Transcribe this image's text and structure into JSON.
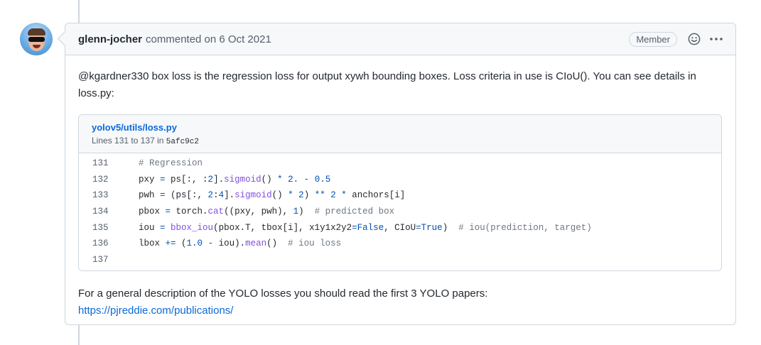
{
  "comment": {
    "author": "glenn-jocher",
    "meta": "commented on 6 Oct 2021",
    "badge": "Member",
    "body_text": "@kgardner330 box loss is the regression loss for output xywh bounding boxes. Loss criteria in use is CIoU(). You can see details in loss.py:",
    "icons": {
      "reaction": "smiley-icon",
      "more": "kebab-horizontal-icon"
    }
  },
  "snippet": {
    "file_path": "yolov5/utils/loss.py",
    "lines_prefix": "Lines 131 to 137 in",
    "sha": "5afc9c2",
    "lines": [
      {
        "num": "131",
        "text": "# Regression"
      },
      {
        "num": "132",
        "text": "pxy = ps[:, :2].sigmoid() * 2. - 0.5"
      },
      {
        "num": "133",
        "text": "pwh = (ps[:, 2:4].sigmoid() * 2) ** 2 * anchors[i]"
      },
      {
        "num": "134",
        "text": "pbox = torch.cat((pxy, pwh), 1)  # predicted box"
      },
      {
        "num": "135",
        "text": "iou = bbox_iou(pbox.T, tbox[i], x1y1x2y2=False, CIoU=True)  # iou(prediction, target)"
      },
      {
        "num": "136",
        "text": "lbox += (1.0 - iou).mean()  # iou loss"
      },
      {
        "num": "137",
        "text": ""
      }
    ]
  },
  "footer": {
    "text": "For a general description of the YOLO losses you should read the first 3 YOLO papers:",
    "link": "https://pjreddie.com/publications/"
  },
  "colors": {
    "link": "#0969da",
    "border": "#d0d7de",
    "header_bg": "#f6f8fa",
    "muted": "#57606a"
  }
}
